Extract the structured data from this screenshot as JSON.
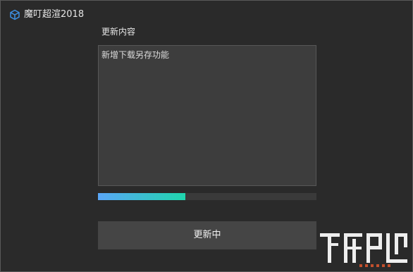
{
  "window": {
    "title": "魔叮超渲2018",
    "icon": "cube-outline-icon"
  },
  "update": {
    "section_label": "更新内容",
    "notes": "新增下载另存功能",
    "progress_fraction": 0.4,
    "button_label": "更新中"
  },
  "colors": {
    "window_bg": "#2a2a2a",
    "box_bg": "#3d3d3d",
    "button_bg": "#454545",
    "progress_start": "#5aa6f7",
    "progress_end": "#1fd6ad",
    "icon_accent": "#3d8fe0"
  }
}
